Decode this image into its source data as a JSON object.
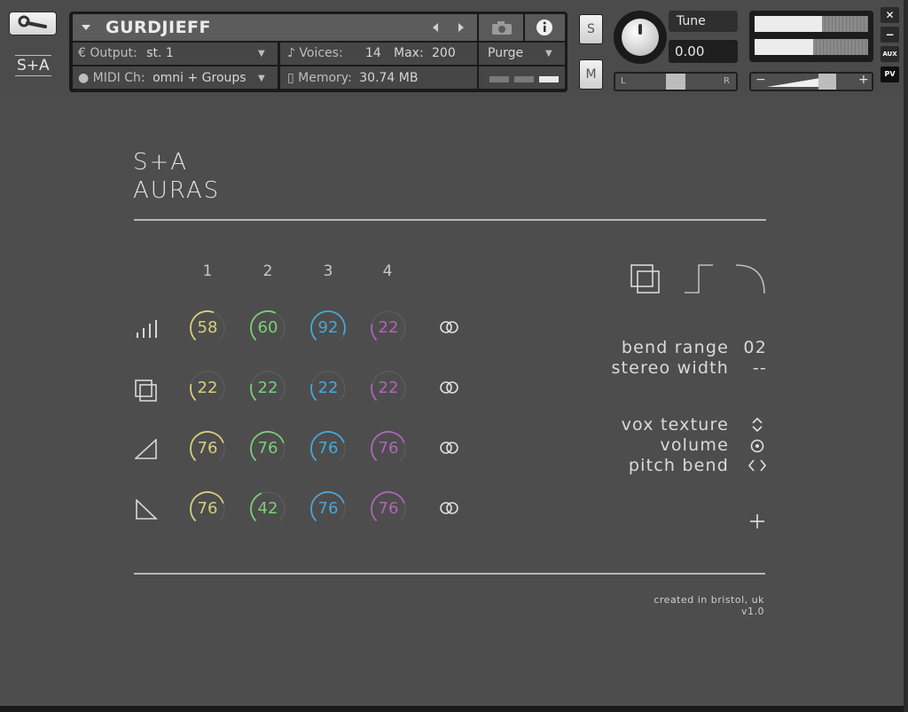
{
  "header": {
    "instrument_name": "GURDJIEFF",
    "output_label": "Output:",
    "output_value": "st. 1",
    "midi_label": "MIDI Ch:",
    "midi_value": "omni + Groups",
    "voices_label": "Voices:",
    "voices_value": "14",
    "max_label": "Max:",
    "max_value": "200",
    "memory_label": "Memory:",
    "memory_value": "30.74 MB",
    "purge_label": "Purge",
    "solo_label": "S",
    "mute_label": "M",
    "tune_label": "Tune",
    "tune_value": "0.00",
    "pan_left": "L",
    "pan_right": "R",
    "vol_minus": "−",
    "vol_plus": "+",
    "aux_label": "AUX",
    "pv_label": "PV",
    "close_label": "✕",
    "minimize_label": "−",
    "logo_text": "S+A"
  },
  "main": {
    "title_line1": "S+A",
    "title_line2": "AURAS",
    "columns": [
      "1",
      "2",
      "3",
      "4"
    ],
    "rows": [
      {
        "icon": "bars-icon",
        "values": [
          "58",
          "60",
          "92",
          "22"
        ]
      },
      {
        "icon": "layers-icon",
        "values": [
          "22",
          "22",
          "22",
          "22"
        ]
      },
      {
        "icon": "attack-icon",
        "values": [
          "76",
          "76",
          "76",
          "76"
        ]
      },
      {
        "icon": "release-icon",
        "values": [
          "76",
          "42",
          "76",
          "76"
        ]
      }
    ],
    "knob_levels": [
      [
        0.58,
        0.6,
        0.92,
        0.22
      ],
      [
        0.22,
        0.22,
        0.22,
        0.22
      ],
      [
        0.76,
        0.76,
        0.76,
        0.76
      ],
      [
        0.76,
        0.42,
        0.76,
        0.76
      ]
    ],
    "column_colors": [
      "#d9cf7a",
      "#7ccf7a",
      "#4aa6d8",
      "#b065b8"
    ],
    "link_icon": "link-icon",
    "bend_range_label": "bend range",
    "bend_range_value": "02",
    "stereo_width_label": "stereo width",
    "stereo_width_value": "--",
    "vox_texture_label": "vox texture",
    "volume_label": "volume",
    "pitch_bend_label": "pitch bend",
    "credit_line1": "created in bristol, uk",
    "credit_line2": "v1.0"
  }
}
